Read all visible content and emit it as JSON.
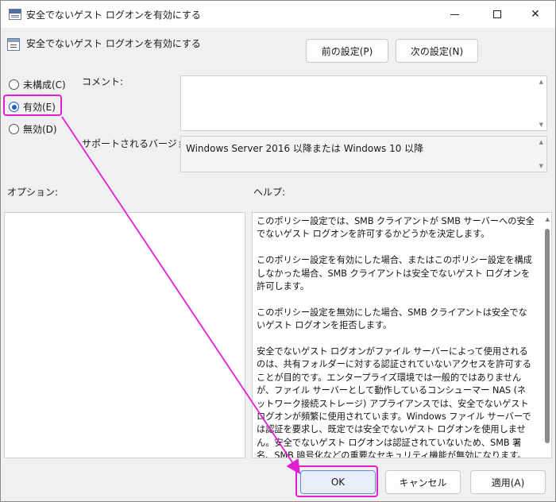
{
  "window": {
    "title": "安全でないゲスト ログオンを有効にする",
    "controls": {
      "minimize": "minimize",
      "maximize": "maximize",
      "close": "✕"
    }
  },
  "header": {
    "setting_title": "安全でないゲスト ログオンを有効にする",
    "prev_button": "前の設定(P)",
    "next_button": "次の設定(N)"
  },
  "state": {
    "options": [
      {
        "label": "未構成(C)",
        "selected": false
      },
      {
        "label": "有効(E)",
        "selected": true
      },
      {
        "label": "無効(D)",
        "selected": false
      }
    ]
  },
  "comment": {
    "label": "コメント:",
    "value": ""
  },
  "supported": {
    "label": "サポートされるバージョン:",
    "value": "Windows Server 2016 以降または Windows 10 以降"
  },
  "options_panel": {
    "label": "オプション:"
  },
  "help_panel": {
    "label": "ヘルプ:",
    "paragraphs": [
      "このポリシー設定では、SMB クライアントが SMB サーバーへの安全でないゲスト ログオンを許可するかどうかを決定します。",
      "このポリシー設定を有効にした場合、またはこのポリシー設定を構成しなかった場合、SMB クライアントは安全でないゲスト ログオンを許可します。",
      "このポリシー設定を無効にした場合、SMB クライアントは安全でないゲスト ログオンを拒否します。",
      "安全でないゲスト ログオンがファイル サーバーによって使用されるのは、共有フォルダーに対する認証されていないアクセスを許可することが目的です。エンタープライズ環境では一般的ではありませんが、ファイル サーバーとして動作しているコンシューマー NAS (ネットワーク接続ストレージ) アプライアンスでは、安全でないゲスト ログオンが頻繁に使用されています。Windows ファイル サーバーでは認証を要求し、既定では安全でないゲスト ログオンを使用しません。安全でないゲスト ログオンは認証されていないため、SMB 署名、SMB 暗号化などの重要なセキュリティ機能が無効になります。結果として、安全でないゲスト ログオンを許可するクライアントは、さまざまな man-in-the-middle 攻撃に対して脆弱になり、データ損失、データの破損、マルウェアに"
    ]
  },
  "footer": {
    "ok": "OK",
    "cancel": "キャンセル",
    "apply": "適用(A)"
  },
  "annotation": {
    "color": "#e020d0"
  }
}
